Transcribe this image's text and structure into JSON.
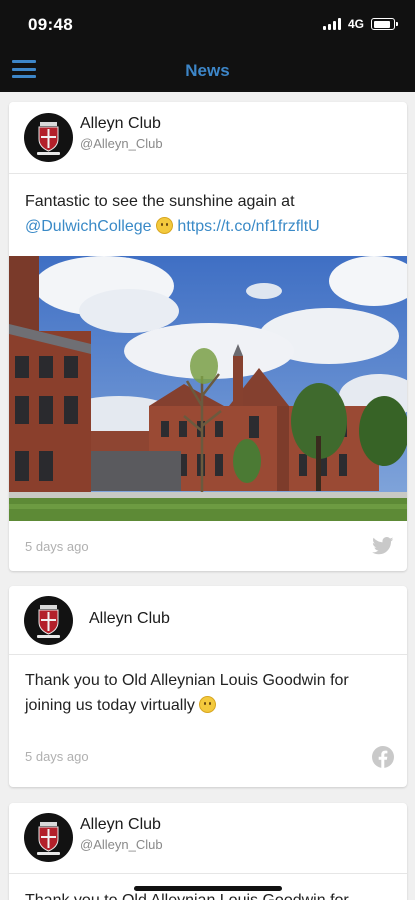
{
  "status_bar": {
    "time": "09:48",
    "network": "4G",
    "battery_level": 0.85,
    "signal_bars": 4
  },
  "nav": {
    "title": "News",
    "menu_icon": "hamburger-menu-icon"
  },
  "posts": [
    {
      "name": "Alleyn Club",
      "handle": "@Alleyn_Club",
      "text_before": "Fantastic to see the sunshine again at ",
      "mention": "@DulwichCollege",
      "text_link": "https://t.co/nf1frzfltU",
      "emoji": "smiling-face-emoji",
      "has_photo": true,
      "photo_subject": "dulwich-college-building-photo",
      "time": "5 days ago",
      "source": "twitter-icon",
      "source_color": "#c9c9c9"
    },
    {
      "name": "Alleyn Club",
      "text": "Thank you to Old Alleynian Louis Goodwin for joining us today virtually",
      "emoji": "grinning-face-emoji",
      "time": "5 days ago",
      "source": "facebook-icon",
      "source_color": "#c9c9c9"
    },
    {
      "name": "Alleyn Club",
      "handle": "@Alleyn_Club",
      "text": "Thank you to Old Alleynian Louis Goodwin for"
    }
  ],
  "colors": {
    "accent": "#3d86c8",
    "link": "#3a8ac7",
    "feed_background": "#f0f0f0",
    "bar_background": "#111111"
  }
}
